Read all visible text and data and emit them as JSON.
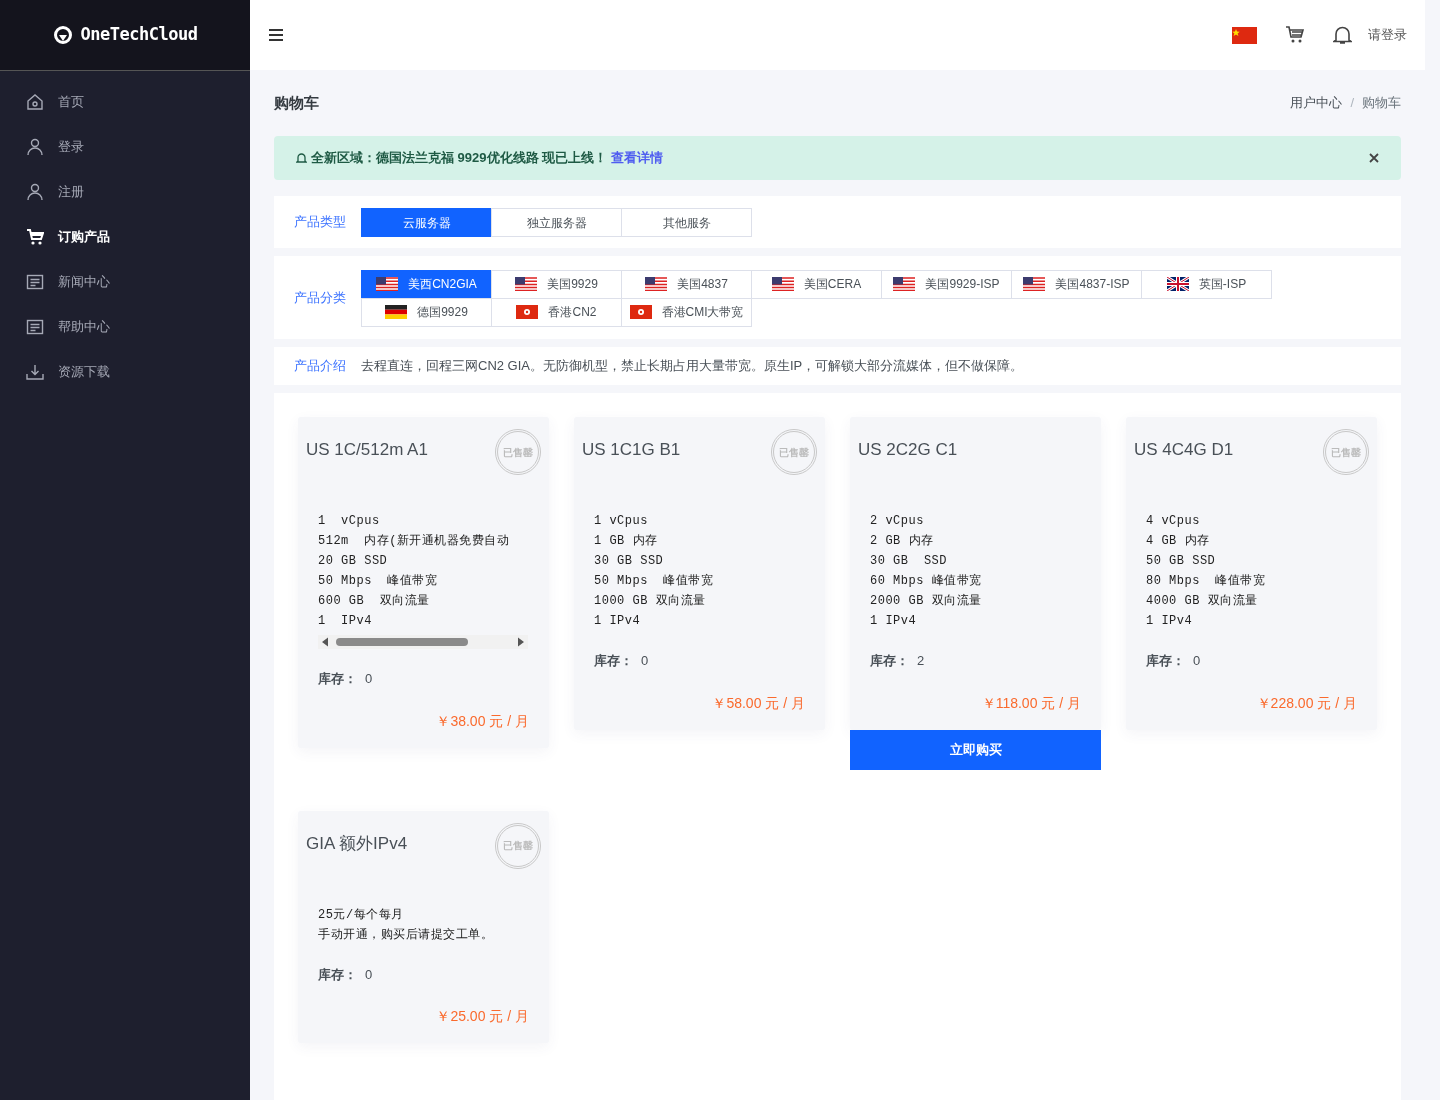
{
  "brand": "OneTechCloud",
  "sidebar": {
    "items": [
      {
        "label": "首页",
        "kind": "home",
        "selected": false
      },
      {
        "label": "登录",
        "kind": "user",
        "selected": false
      },
      {
        "label": "注册",
        "kind": "user",
        "selected": false
      },
      {
        "label": "订购产品",
        "kind": "cart",
        "selected": true
      },
      {
        "label": "新闻中心",
        "kind": "doc",
        "selected": false
      },
      {
        "label": "帮助中心",
        "kind": "doc",
        "selected": false
      },
      {
        "label": "资源下载",
        "kind": "download",
        "selected": false
      }
    ]
  },
  "header": {
    "login": "请登录"
  },
  "page_title": "购物车",
  "breadcrumb": {
    "items": [
      "用户中心",
      "购物车"
    ],
    "separator": "/"
  },
  "alert": {
    "text": "全新区域：德国法兰克福 9929优化线路 现已上线！",
    "link": "查看详情"
  },
  "product_type": {
    "label": "产品类型",
    "tabs": [
      {
        "label": "云服务器",
        "selected": true
      },
      {
        "label": "独立服务器",
        "selected": false
      },
      {
        "label": "其他服务",
        "selected": false
      }
    ]
  },
  "category": {
    "label": "产品分类",
    "items": [
      {
        "label": "美西CN2GIA",
        "kind": "us",
        "selected": true
      },
      {
        "label": "美国9929",
        "kind": "us",
        "selected": false
      },
      {
        "label": "美国4837",
        "kind": "us",
        "selected": false
      },
      {
        "label": "美国CERA",
        "kind": "us",
        "selected": false
      },
      {
        "label": "美国9929-ISP",
        "kind": "us",
        "selected": false
      },
      {
        "label": "美国4837-ISP",
        "kind": "us",
        "selected": false
      },
      {
        "label": "英国-ISP",
        "kind": "gb",
        "selected": false
      },
      {
        "label": "德国9929",
        "kind": "de",
        "selected": false
      },
      {
        "label": "香港CN2",
        "kind": "hk",
        "selected": false
      },
      {
        "label": "香港CMI大带宽",
        "kind": "hk",
        "selected": false
      }
    ]
  },
  "intro": {
    "label": "产品介绍",
    "text": "去程直连，回程三网CN2 GIA。无防御机型，禁止长期占用大量带宽。原生IP，可解锁大部分流媒体，但不做保障。"
  },
  "products": [
    {
      "name": "US 1C/512m A1",
      "stamp": "已售罄",
      "specs": [
        "1  vCpus",
        "512m  内存(新开通机器免费自动",
        "20 GB SSD",
        "50 Mbps  峰值带宽",
        "600 GB  双向流量",
        "1  IPv4"
      ],
      "overflow": true,
      "stock_label": "库存：",
      "stock": "0",
      "price": "￥38.00 元 / 月"
    },
    {
      "name": "US 1C1G B1",
      "stamp": "已售罄",
      "specs": [
        "1 vCpus",
        "1 GB 内存",
        "30 GB SSD",
        "50 Mbps  峰值带宽",
        "1000 GB 双向流量",
        "1 IPv4"
      ],
      "overflow": false,
      "stock_label": "库存：",
      "stock": "0",
      "price": "￥58.00 元 / 月"
    },
    {
      "name": "US 2C2G C1",
      "specs": [
        "2 vCpus",
        "2 GB 内存",
        "30 GB  SSD",
        "60 Mbps 峰值带宽",
        "2000 GB 双向流量",
        "1 IPv4"
      ],
      "overflow": false,
      "stock_label": "库存：",
      "stock": "2",
      "price": "￥118.00 元 / 月",
      "button": "立即购买"
    },
    {
      "name": "US 4C4G D1",
      "stamp": "已售罄",
      "specs": [
        "4 vCpus",
        "4 GB 内存",
        "50 GB SSD",
        "80 Mbps  峰值带宽",
        "4000 GB 双向流量",
        "1 IPv4"
      ],
      "overflow": false,
      "stock_label": "库存：",
      "stock": "0",
      "price": "￥228.00 元 / 月"
    },
    {
      "name": "GIA 额外IPv4",
      "stamp": "已售罄",
      "specs": [
        "25元/每个每月",
        "手动开通，购买后请提交工单。"
      ],
      "overflow": false,
      "stock_label": "库存：",
      "stock": "0",
      "price": "￥25.00 元 / 月"
    }
  ]
}
